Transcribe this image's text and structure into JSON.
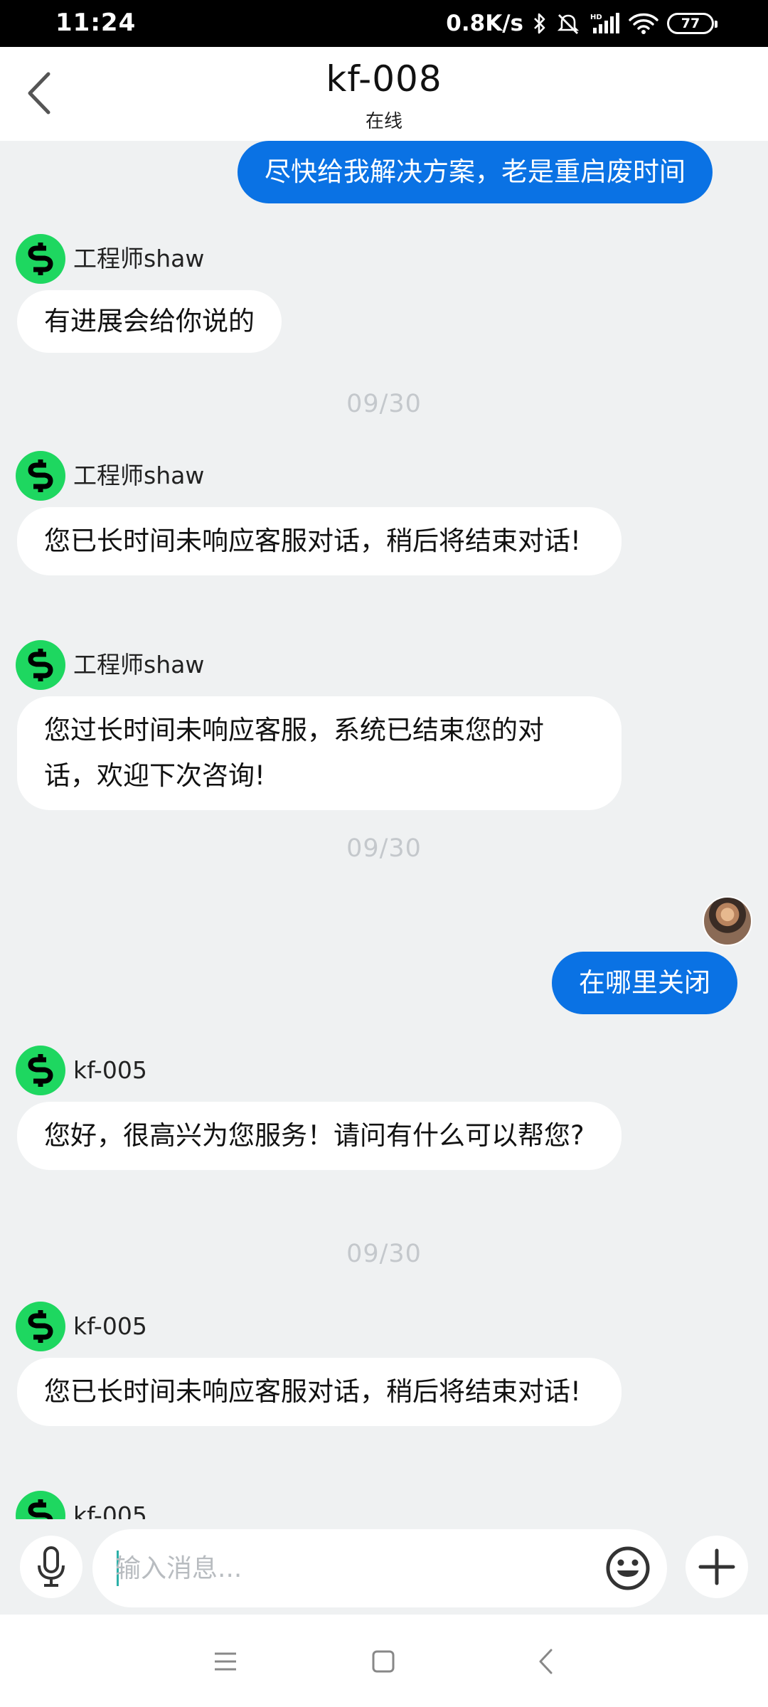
{
  "status_bar": {
    "time": "11:24",
    "network_speed": "0.8K/s",
    "battery": "77",
    "icons": [
      "bluetooth-icon",
      "mute-icon",
      "signal-icon",
      "wifi-icon",
      "battery-icon"
    ]
  },
  "header": {
    "title": "kf-008",
    "subtitle": "在线"
  },
  "messages": [
    {
      "type": "outgoing",
      "text": "尽快给我解决方案，老是重启废时间"
    },
    {
      "type": "incoming",
      "sender": "工程师shaw",
      "text": "有进展会给你说的"
    },
    {
      "type": "date",
      "text": "09/30"
    },
    {
      "type": "incoming",
      "sender": "工程师shaw",
      "text": "您已长时间未响应客服对话，稍后将结束对话!"
    },
    {
      "type": "incoming",
      "sender": "工程师shaw",
      "text": "您过长时间未响应客服，系统已结束您的对话，欢迎下次咨询!"
    },
    {
      "type": "date",
      "text": "09/30"
    },
    {
      "type": "outgoing",
      "text": "在哪里关闭"
    },
    {
      "type": "incoming",
      "sender": "kf-005",
      "text": "您好，很高兴为您服务！请问有什么可以帮您?"
    },
    {
      "type": "date",
      "text": "09/30"
    },
    {
      "type": "incoming",
      "sender": "kf-005",
      "text": "您已长时间未响应客服对话，稍后将结束对话!"
    },
    {
      "type": "incoming",
      "sender": "kf-005",
      "text": ""
    }
  ],
  "input": {
    "placeholder": "输入消息..."
  },
  "colors": {
    "outgoing_bubble": "#0a72e4",
    "bot_avatar": "#1ed760",
    "background": "#eff1f2"
  }
}
